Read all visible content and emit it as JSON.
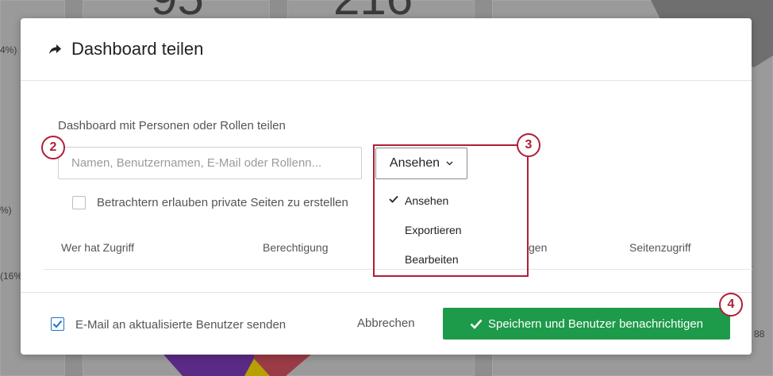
{
  "background": {
    "big_number_1": "95",
    "big_number_2": "216",
    "pct_1": "4%)",
    "pct_2": "%)",
    "pct_3": "(16%",
    "small_number": "88"
  },
  "modal": {
    "title": "Dashboard teilen",
    "share_label": "Dashboard mit Personen oder Rollen teilen",
    "search_placeholder": "Namen, Benutzernamen, E-Mail oder Rollenn...",
    "permission": {
      "selected": "Ansehen",
      "options": [
        "Ansehen",
        "Exportieren",
        "Bearbeiten"
      ]
    },
    "private_pages_label": "Betrachtern erlauben private Seiten zu erstellen",
    "table_headers": [
      "Wer hat Zugriff",
      "Berechtigung",
      "gen",
      "Seitenzugriff"
    ],
    "email_label": "E-Mail an aktualisierte Benutzer senden",
    "cancel_label": "Abbrechen",
    "save_label": "Speichern und Benutzer benachrichtigen"
  },
  "callouts": [
    "2",
    "3",
    "4"
  ],
  "colors": {
    "accent_green": "#1e9a4b",
    "callout_red": "#b01e35",
    "checkbox_blue": "#1a73c4"
  }
}
